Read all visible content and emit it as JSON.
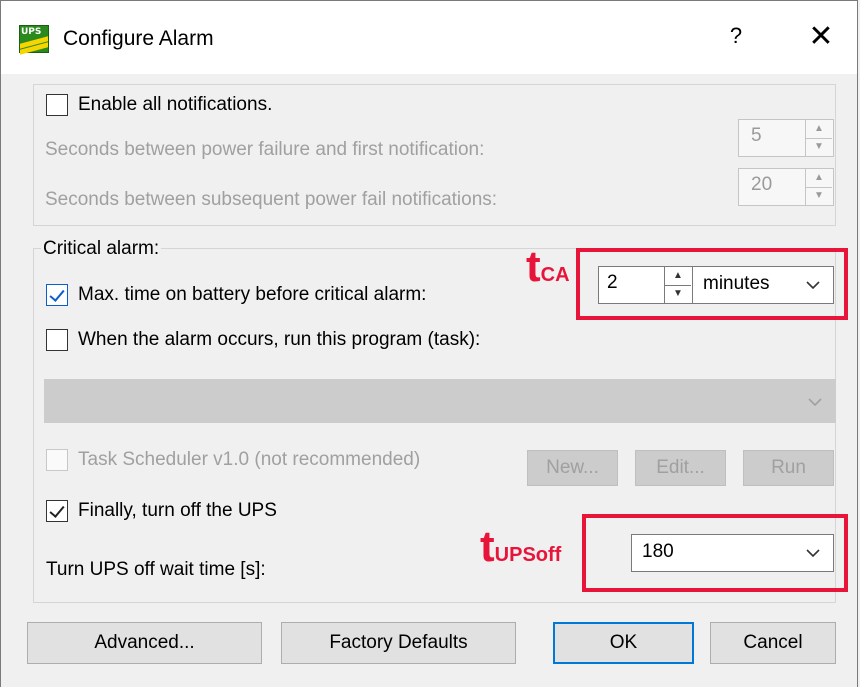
{
  "window": {
    "title": "Configure Alarm",
    "help_glyph": "?",
    "close_glyph": "✕",
    "icon": "ups-app-icon",
    "icon_text": "UPS"
  },
  "notifications": {
    "enable_label": "Enable all notifications.",
    "enable_checked": false,
    "first_label": "Seconds between power failure and first notification:",
    "first_value": "5",
    "subsequent_label": "Seconds between subsequent power fail notifications:",
    "subsequent_value": "20"
  },
  "critical": {
    "group_label": "Critical alarm:",
    "max_time_label": "Max. time on battery before critical alarm:",
    "max_time_checked": true,
    "max_time_value": "2",
    "max_time_unit": "minutes",
    "run_program_label": "When the alarm occurs, run this program (task):",
    "run_program_checked": false,
    "program_value": "",
    "task_scheduler_label": "Task Scheduler v1.0 (not recommended)",
    "new_button": "New...",
    "edit_button": "Edit...",
    "run_button": "Run",
    "turn_off_label": "Finally, turn off the UPS",
    "turn_off_checked": true,
    "wait_time_label": "Turn UPS off wait time [s]:",
    "wait_time_value": "180"
  },
  "annotations": {
    "tca_main": "t",
    "tca_sub": "CA",
    "tupsoff_main": "t",
    "tupsoff_sub": "UPSoff",
    "color": "#e8153a"
  },
  "buttons": {
    "advanced": "Advanced...",
    "factory_defaults": "Factory Defaults",
    "ok": "OK",
    "cancel": "Cancel"
  },
  "colors": {
    "window_bg": "#f0f0f0",
    "accent": "#0078d7",
    "annotation": "#e8153a"
  }
}
